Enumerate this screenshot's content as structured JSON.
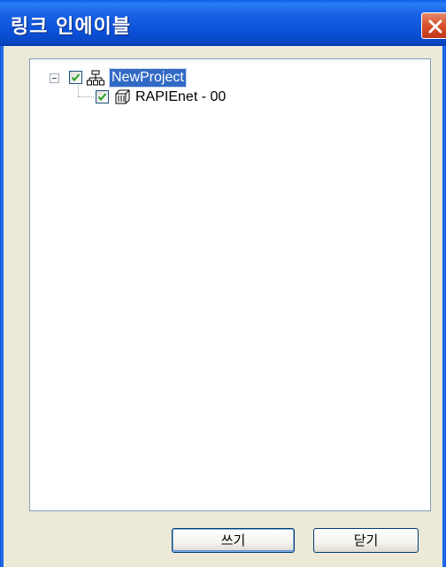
{
  "window": {
    "title": "링크 인에이블"
  },
  "tree": {
    "root": {
      "label": "NewProject",
      "checked": true,
      "expanded": true,
      "selected": true,
      "icon": "network-icon"
    },
    "children": [
      {
        "label": "RAPIEnet - 00",
        "checked": true,
        "icon": "module-icon"
      }
    ]
  },
  "buttons": {
    "write_label": "쓰기",
    "close_label": "닫기"
  }
}
